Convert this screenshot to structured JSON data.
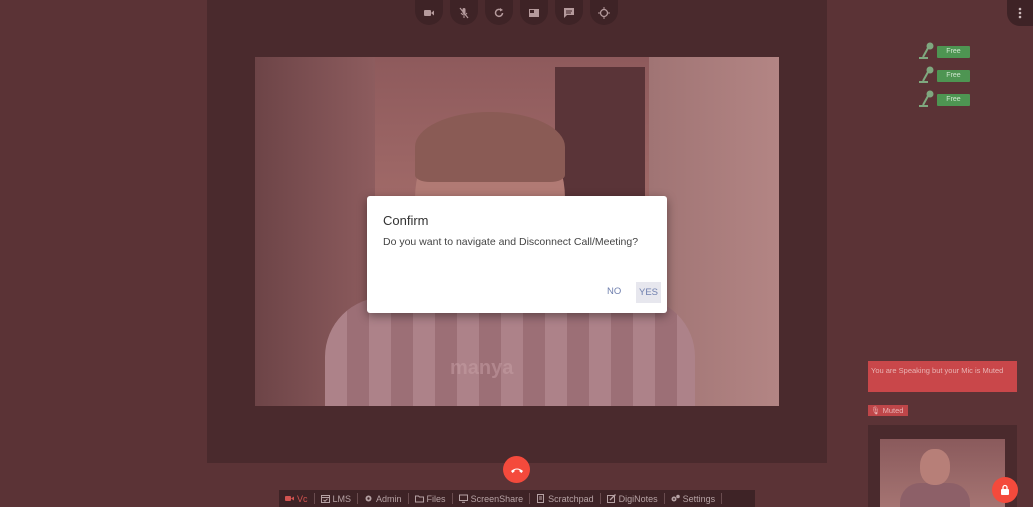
{
  "dialog": {
    "title": "Confirm",
    "message": "Do you want to navigate and Disconnect Call/Meeting?",
    "no_label": "NO",
    "yes_label": "YES"
  },
  "seats": [
    {
      "label": "Free"
    },
    {
      "label": "Free"
    },
    {
      "label": "Free"
    }
  ],
  "status": {
    "mic_warning": "You are Speaking but your Mic is Muted",
    "muted_badge": "Muted"
  },
  "video": {
    "watermark": "manya"
  },
  "bottom_tabs": [
    {
      "label": "Vc",
      "icon": "video-camera-icon",
      "active": true
    },
    {
      "label": "LMS",
      "icon": "calendar-check-icon"
    },
    {
      "label": "Admin",
      "icon": "gear-icon"
    },
    {
      "label": "Files",
      "icon": "folder-open-icon"
    },
    {
      "label": "ScreenShare",
      "icon": "monitor-icon"
    },
    {
      "label": "Scratchpad",
      "icon": "document-icon"
    },
    {
      "label": "DigiNotes",
      "icon": "edit-icon"
    },
    {
      "label": "Settings",
      "icon": "gears-icon"
    }
  ],
  "top_controls": [
    "video-camera-icon",
    "mic-off-icon",
    "refresh-icon",
    "layout-icon",
    "chat-icon",
    "crosshair-icon"
  ],
  "colors": {
    "accent_red": "#f44a3c",
    "seat_green": "#4e9552",
    "warning_red": "#c9474a"
  }
}
